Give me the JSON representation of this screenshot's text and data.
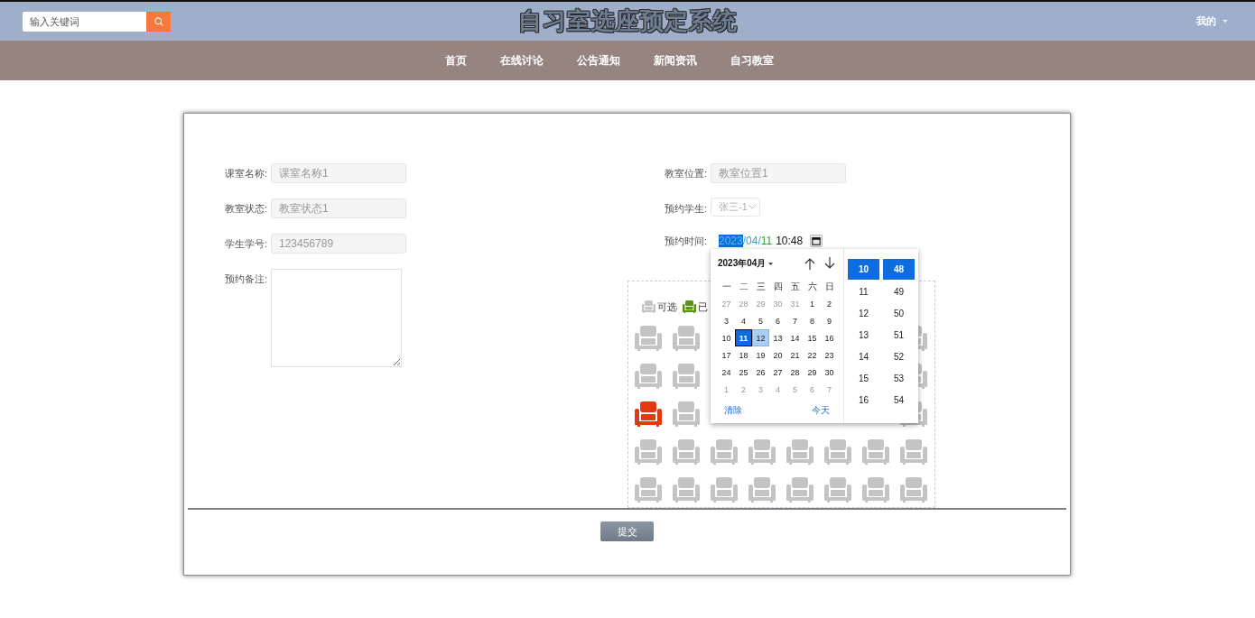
{
  "header": {
    "search": {
      "placeholder": "输入关键词"
    },
    "title": "自习室选座预定系统",
    "user_menu": "我的"
  },
  "nav": [
    {
      "label": "首页"
    },
    {
      "label": "在线讨论"
    },
    {
      "label": "公告通知"
    },
    {
      "label": "新闻资讯"
    },
    {
      "label": "自习教室"
    }
  ],
  "form": {
    "left": [
      {
        "kind": "input",
        "label": "课室名称:",
        "value": "课室名称1"
      },
      {
        "kind": "input",
        "label": "教室状态:",
        "value": "教室状态1"
      },
      {
        "kind": "input",
        "label": "学生学号:",
        "value": "123456789"
      },
      {
        "kind": "textarea",
        "label": "预约备注:"
      }
    ],
    "right": [
      {
        "kind": "input",
        "label": "教室位置:",
        "value": "教室位置1"
      },
      {
        "kind": "select",
        "label": "预约学生:",
        "value": "张三-1"
      },
      {
        "kind": "datetime",
        "label": "预约时间:",
        "segments": [
          {
            "kind": "highlight",
            "text": "2023"
          },
          {
            "kind": "month",
            "text": "/04/"
          },
          {
            "kind": "day",
            "text": "11"
          },
          {
            "kind": "time",
            "text": "10:48"
          }
        ]
      }
    ]
  },
  "date_picker": {
    "month_label": "2023年04月",
    "weekdays": [
      "一",
      "二",
      "三",
      "四",
      "五",
      "六",
      "日"
    ],
    "weeks": [
      [
        {
          "d": "27",
          "outside": true,
          "selected": false,
          "hovered": false
        },
        {
          "d": "28",
          "outside": true,
          "selected": false,
          "hovered": false
        },
        {
          "d": "29",
          "outside": true,
          "selected": false,
          "hovered": false
        },
        {
          "d": "30",
          "outside": true,
          "selected": false,
          "hovered": false
        },
        {
          "d": "31",
          "outside": true,
          "selected": false,
          "hovered": false
        },
        {
          "d": "1",
          "outside": false,
          "selected": false,
          "hovered": false
        },
        {
          "d": "2",
          "outside": false,
          "selected": false,
          "hovered": false
        }
      ],
      [
        {
          "d": "3",
          "outside": false,
          "selected": false,
          "hovered": false
        },
        {
          "d": "4",
          "outside": false,
          "selected": false,
          "hovered": false
        },
        {
          "d": "5",
          "outside": false,
          "selected": false,
          "hovered": false
        },
        {
          "d": "6",
          "outside": false,
          "selected": false,
          "hovered": false
        },
        {
          "d": "7",
          "outside": false,
          "selected": false,
          "hovered": false
        },
        {
          "d": "8",
          "outside": false,
          "selected": false,
          "hovered": false
        },
        {
          "d": "9",
          "outside": false,
          "selected": false,
          "hovered": false
        }
      ],
      [
        {
          "d": "10",
          "outside": false,
          "selected": false,
          "hovered": false
        },
        {
          "d": "11",
          "outside": false,
          "selected": true,
          "hovered": false
        },
        {
          "d": "12",
          "outside": false,
          "selected": false,
          "hovered": true
        },
        {
          "d": "13",
          "outside": false,
          "selected": false,
          "hovered": false
        },
        {
          "d": "14",
          "outside": false,
          "selected": false,
          "hovered": false
        },
        {
          "d": "15",
          "outside": false,
          "selected": false,
          "hovered": false
        },
        {
          "d": "16",
          "outside": false,
          "selected": false,
          "hovered": false
        }
      ],
      [
        {
          "d": "17",
          "outside": false,
          "selected": false,
          "hovered": false
        },
        {
          "d": "18",
          "outside": false,
          "selected": false,
          "hovered": false
        },
        {
          "d": "19",
          "outside": false,
          "selected": false,
          "hovered": false
        },
        {
          "d": "20",
          "outside": false,
          "selected": false,
          "hovered": false
        },
        {
          "d": "21",
          "outside": false,
          "selected": false,
          "hovered": false
        },
        {
          "d": "22",
          "outside": false,
          "selected": false,
          "hovered": false
        },
        {
          "d": "23",
          "outside": false,
          "selected": false,
          "hovered": false
        }
      ],
      [
        {
          "d": "24",
          "outside": false,
          "selected": false,
          "hovered": false
        },
        {
          "d": "25",
          "outside": false,
          "selected": false,
          "hovered": false
        },
        {
          "d": "26",
          "outside": false,
          "selected": false,
          "hovered": false
        },
        {
          "d": "27",
          "outside": false,
          "selected": false,
          "hovered": false
        },
        {
          "d": "28",
          "outside": false,
          "selected": false,
          "hovered": false
        },
        {
          "d": "29",
          "outside": false,
          "selected": false,
          "hovered": false
        },
        {
          "d": "30",
          "outside": false,
          "selected": false,
          "hovered": false
        }
      ],
      [
        {
          "d": "1",
          "outside": true,
          "selected": false,
          "hovered": false
        },
        {
          "d": "2",
          "outside": true,
          "selected": false,
          "hovered": false
        },
        {
          "d": "3",
          "outside": true,
          "selected": false,
          "hovered": false
        },
        {
          "d": "4",
          "outside": true,
          "selected": false,
          "hovered": false
        },
        {
          "d": "5",
          "outside": true,
          "selected": false,
          "hovered": false
        },
        {
          "d": "6",
          "outside": true,
          "selected": false,
          "hovered": false
        },
        {
          "d": "7",
          "outside": true,
          "selected": false,
          "hovered": false
        }
      ]
    ],
    "clear": "清除",
    "today": "今天",
    "hours": [
      {
        "label": "10",
        "selected": true
      },
      {
        "label": "11",
        "selected": false
      },
      {
        "label": "12",
        "selected": false
      },
      {
        "label": "13",
        "selected": false
      },
      {
        "label": "14",
        "selected": false
      },
      {
        "label": "15",
        "selected": false
      },
      {
        "label": "16",
        "selected": false
      }
    ],
    "minutes": [
      {
        "label": "48",
        "selected": true
      },
      {
        "label": "49",
        "selected": false
      },
      {
        "label": "50",
        "selected": false
      },
      {
        "label": "51",
        "selected": false
      },
      {
        "label": "52",
        "selected": false
      },
      {
        "label": "53",
        "selected": false
      },
      {
        "label": "54",
        "selected": false
      }
    ]
  },
  "seat_map": {
    "legend": [
      {
        "kind": "available",
        "label": "可选"
      },
      {
        "kind": "selected",
        "label": "已"
      }
    ],
    "rows": [
      {
        "seats": [
          {
            "kind": "available"
          },
          {
            "kind": "available"
          },
          {
            "kind": "covered"
          },
          {
            "kind": "covered"
          },
          {
            "kind": "covered"
          },
          {
            "kind": "covered"
          },
          {
            "kind": "covered"
          },
          {
            "kind": "available"
          }
        ]
      },
      {
        "seats": [
          {
            "kind": "available"
          },
          {
            "kind": "available"
          },
          {
            "kind": "covered"
          },
          {
            "kind": "covered"
          },
          {
            "kind": "covered"
          },
          {
            "kind": "covered"
          },
          {
            "kind": "covered"
          },
          {
            "kind": "available"
          }
        ]
      },
      {
        "seats": [
          {
            "kind": "occupied"
          },
          {
            "kind": "available"
          },
          {
            "kind": "covered"
          },
          {
            "kind": "covered"
          },
          {
            "kind": "covered"
          },
          {
            "kind": "covered"
          },
          {
            "kind": "covered"
          },
          {
            "kind": "available"
          }
        ]
      },
      {
        "seats": [
          {
            "kind": "available"
          },
          {
            "kind": "available"
          },
          {
            "kind": "available"
          },
          {
            "kind": "available"
          },
          {
            "kind": "available"
          },
          {
            "kind": "available"
          },
          {
            "kind": "available"
          },
          {
            "kind": "available"
          }
        ]
      },
      {
        "seats": [
          {
            "kind": "available"
          },
          {
            "kind": "available"
          },
          {
            "kind": "available"
          },
          {
            "kind": "available"
          },
          {
            "kind": "available"
          },
          {
            "kind": "available"
          },
          {
            "kind": "available"
          },
          {
            "kind": "available"
          }
        ]
      }
    ]
  },
  "submit": "提交"
}
